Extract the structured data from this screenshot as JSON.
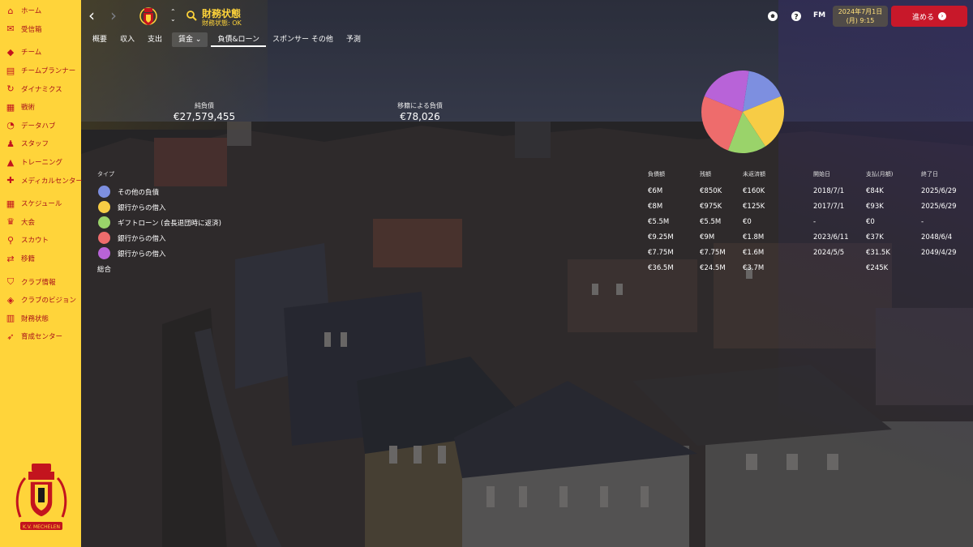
{
  "sidebar": {
    "items": [
      {
        "label": "ホーム",
        "icon": "home-icon"
      },
      {
        "label": "受信箱",
        "icon": "inbox-icon"
      },
      {
        "label": "チーム",
        "icon": "team-icon"
      },
      {
        "label": "チームプランナー",
        "icon": "clipboard-icon"
      },
      {
        "label": "ダイナミクス",
        "icon": "dynamics-icon"
      },
      {
        "label": "戦術",
        "icon": "tactics-icon"
      },
      {
        "label": "データハブ",
        "icon": "data-hub-icon"
      },
      {
        "label": "スタッフ",
        "icon": "staff-icon"
      },
      {
        "label": "トレーニング",
        "icon": "training-icon"
      },
      {
        "label": "メディカルセンター",
        "icon": "medical-icon"
      },
      {
        "label": "スケジュール",
        "icon": "calendar-icon"
      },
      {
        "label": "大会",
        "icon": "trophy-icon"
      },
      {
        "label": "スカウト",
        "icon": "scout-icon"
      },
      {
        "label": "移籍",
        "icon": "transfer-icon"
      },
      {
        "label": "クラブ情報",
        "icon": "club-info-icon"
      },
      {
        "label": "クラブのビジョン",
        "icon": "vision-icon"
      },
      {
        "label": "財務状態",
        "icon": "finance-icon"
      },
      {
        "label": "育成センター",
        "icon": "youth-icon"
      }
    ],
    "crest_text": "K.V. MECHELEN"
  },
  "header": {
    "title": "財務状態",
    "subtitle": "財務状態: OK",
    "date_line1": "2024年7月1日",
    "date_line2": "(月) 9:15",
    "continue_label": "進める",
    "fm_label": "FM"
  },
  "tabs": [
    {
      "label": "概要"
    },
    {
      "label": "収入"
    },
    {
      "label": "支出"
    },
    {
      "label": "賃金 ⌄"
    },
    {
      "label": "負債&ローン"
    },
    {
      "label": "スポンサー その他"
    },
    {
      "label": "予測"
    }
  ],
  "summary": {
    "total_debt_label": "純負債",
    "total_debt_value": "€27,579,455",
    "transfer_debt_label": "移籍による負債",
    "transfer_debt_value": "€78,026"
  },
  "table": {
    "headers": [
      "タイプ",
      "負債額",
      "残額",
      "未返済額",
      "開始日",
      "支払(月額)",
      "終了日"
    ],
    "rows": [
      {
        "type": "その他の負債",
        "color": "#7d8fe0",
        "amount": "€6M",
        "remaining": "€850K",
        "unpaid": "€160K",
        "start": "2018/7/1",
        "monthly": "€84K",
        "end": "2025/6/29"
      },
      {
        "type": "銀行からの借入",
        "color": "#f7cc45",
        "amount": "€8M",
        "remaining": "€975K",
        "unpaid": "€125K",
        "start": "2017/7/1",
        "monthly": "€93K",
        "end": "2025/6/29"
      },
      {
        "type": "ギフトローン (会長退団時に返済)",
        "color": "#9ad36a",
        "amount": "€5.5M",
        "remaining": "€5.5M",
        "unpaid": "€0",
        "start": "-",
        "monthly": "€0",
        "end": "-"
      },
      {
        "type": "銀行からの借入",
        "color": "#ee6c6c",
        "amount": "€9.25M",
        "remaining": "€9M",
        "unpaid": "€1.8M",
        "start": "2023/6/11",
        "monthly": "€37K",
        "end": "2048/6/4"
      },
      {
        "type": "銀行からの借入",
        "color": "#b863d8",
        "amount": "€7.75M",
        "remaining": "€7.75M",
        "unpaid": "€1.6M",
        "start": "2024/5/5",
        "monthly": "€31.5K",
        "end": "2049/4/29"
      },
      {
        "type": "総合",
        "color": "",
        "amount": "€36.5M",
        "remaining": "€24.5M",
        "unpaid": "€3.7M",
        "start": "",
        "monthly": "€245K",
        "end": ""
      }
    ]
  },
  "pie": {
    "slices": [
      {
        "label": "その他の負債",
        "value": 6,
        "color": "#7d8fe0"
      },
      {
        "label": "銀行からの借入",
        "value": 8,
        "color": "#f7cc45"
      },
      {
        "label": "ギフトローン (会長退団時に返済)",
        "value": 5.5,
        "color": "#9ad36a"
      },
      {
        "label": "銀行からの借入",
        "value": 9.25,
        "color": "#ee6c6c"
      },
      {
        "label": "銀行からの借入",
        "value": 7.75,
        "color": "#b863d8"
      }
    ]
  },
  "colors": {
    "sidebar_bg": "#ffd43a",
    "sidebar_text": "#a8101a",
    "accent": "#ffd43a",
    "continue_bg": "#c8182a"
  }
}
